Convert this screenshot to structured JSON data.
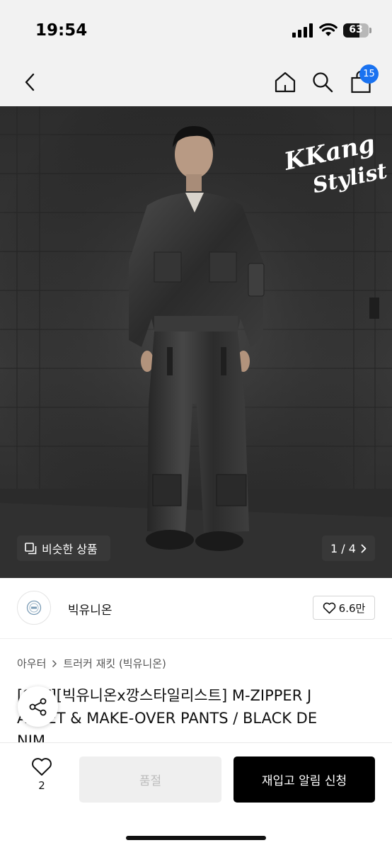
{
  "status_bar": {
    "time": "19:54",
    "battery": "63",
    "battery_level": 0.63
  },
  "nav": {
    "cart_count": "15"
  },
  "gallery": {
    "watermark_line1": "KKang",
    "watermark_line2": "Stylist",
    "similar_label": "비슷한 상품",
    "page_indicator": "1 / 4"
  },
  "brand": {
    "name": "빅유니온",
    "likes": "6.6만"
  },
  "breadcrumb": {
    "items": [
      "아우터",
      "트러커 재킷 (빅유니온)"
    ]
  },
  "product": {
    "title_line1": "[SET][빅유니온x깡스타일리스트] M-ZIPPER J",
    "title_line2": "ACKET & MAKE-OVER PANTS / BLACK DE",
    "title_line3": "NIM"
  },
  "bottom_bar": {
    "wish_count": "2",
    "soldout_label": "품절",
    "restock_label": "재입고 알림 신청"
  },
  "colors": {
    "badge": "#1a72f0",
    "primary_button": "#000000"
  }
}
